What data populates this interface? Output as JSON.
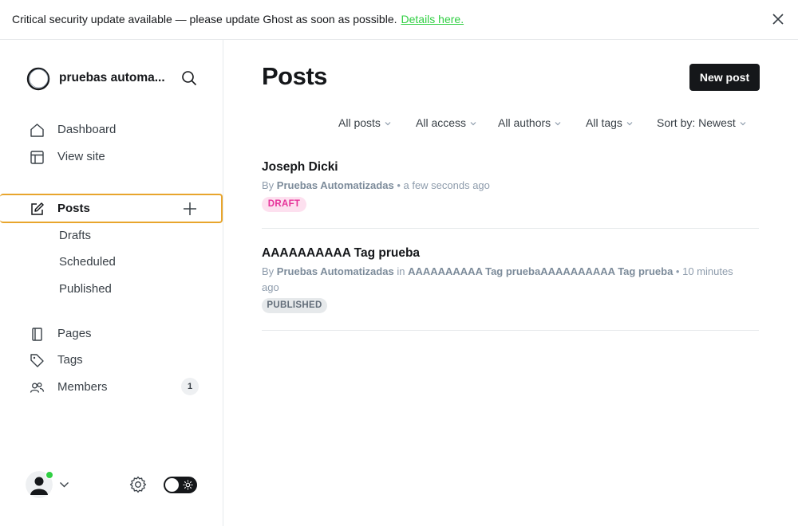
{
  "banner": {
    "text": "Critical security update available — please update Ghost as soon as possible.",
    "link": "Details here."
  },
  "sidebar": {
    "site_title": "pruebas automa...",
    "nav": [
      {
        "label": "Dashboard",
        "icon": "home-icon"
      },
      {
        "label": "View site",
        "icon": "layout-icon"
      },
      {
        "label": "Posts",
        "icon": "edit-icon"
      },
      {
        "label": "Pages",
        "icon": "page-icon"
      },
      {
        "label": "Tags",
        "icon": "tag-icon"
      },
      {
        "label": "Members",
        "icon": "members-icon",
        "count": "1"
      }
    ],
    "sub": [
      "Drafts",
      "Scheduled",
      "Published"
    ]
  },
  "main": {
    "title": "Posts",
    "new_post": "New post",
    "filters": [
      "All posts",
      "All access",
      "All authors",
      "All tags",
      "Sort by: Newest"
    ],
    "posts": [
      {
        "title": "Joseph Dicki",
        "by": "By",
        "author": "Pruebas Automatizadas",
        "time": "a few seconds ago",
        "status": "DRAFT"
      },
      {
        "title": "AAAAAAAAAA Tag prueba",
        "by": "By",
        "author": "Pruebas Automatizadas",
        "in": "in",
        "tag": "AAAAAAAAAA Tag pruebaAAAAAAAAAA Tag prueba",
        "time": "10 minutes ago",
        "status": "PUBLISHED"
      }
    ]
  },
  "colors": {
    "accent_green": "#30cf43",
    "active_border": "#e8a52c",
    "draft_pink": "#e6339a",
    "primary_dark": "#15171a"
  }
}
